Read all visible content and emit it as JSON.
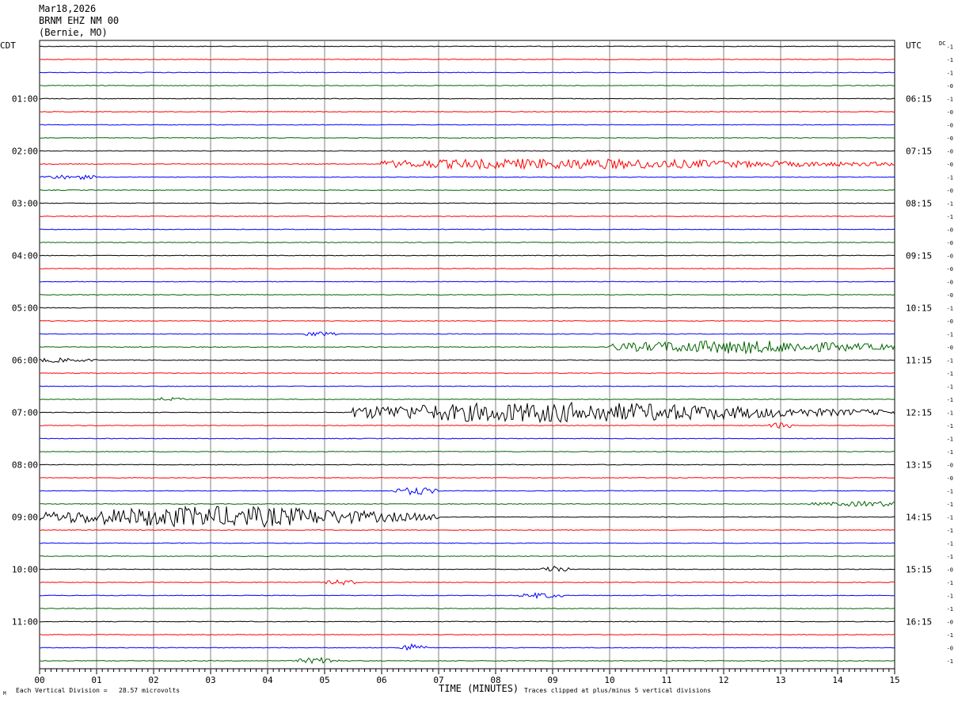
{
  "header": {
    "date": "Mar18,2026",
    "station": "BRNM EHZ NM 00",
    "location": "(Bernie, MO)"
  },
  "labels": {
    "left_tz": "CDT",
    "right_tz": "UTC",
    "dc": "DC",
    "footer_scale": "Each Vertical Division =   28.57 microvolts",
    "footer_title": "TIME (MINUTES)",
    "footer_clip": "Traces clipped at plus/minus 5 vertical divisions",
    "corner_mark": "M"
  },
  "colors": {
    "trace_cycle": [
      "#000000",
      "#ff0000",
      "#0000ff",
      "#006400"
    ],
    "grid": "#808080"
  },
  "chart_data": {
    "type": "helicorder",
    "x_label": "TIME (MINUTES)",
    "x_ticks": [
      "00",
      "01",
      "02",
      "03",
      "04",
      "05",
      "06",
      "07",
      "08",
      "09",
      "10",
      "11",
      "12",
      "13",
      "14",
      "15"
    ],
    "x_range": [
      0,
      15
    ],
    "line_minutes": 15,
    "line_count": 48,
    "left_hour_labels": [
      {
        "line": 4,
        "label": "01:00"
      },
      {
        "line": 8,
        "label": "02:00"
      },
      {
        "line": 12,
        "label": "03:00"
      },
      {
        "line": 16,
        "label": "04:00"
      },
      {
        "line": 20,
        "label": "05:00"
      },
      {
        "line": 24,
        "label": "06:00"
      },
      {
        "line": 28,
        "label": "07:00"
      },
      {
        "line": 32,
        "label": "08:00"
      },
      {
        "line": 36,
        "label": "09:00"
      },
      {
        "line": 40,
        "label": "10:00"
      },
      {
        "line": 44,
        "label": "11:00"
      }
    ],
    "right_hour_labels": [
      {
        "line": 4,
        "label": "06:15"
      },
      {
        "line": 8,
        "label": "07:15"
      },
      {
        "line": 12,
        "label": "08:15"
      },
      {
        "line": 16,
        "label": "09:15"
      },
      {
        "line": 20,
        "label": "10:15"
      },
      {
        "line": 24,
        "label": "11:15"
      },
      {
        "line": 28,
        "label": "12:15"
      },
      {
        "line": 32,
        "label": "13:15"
      },
      {
        "line": 36,
        "label": "14:15"
      },
      {
        "line": 40,
        "label": "15:15"
      },
      {
        "line": 44,
        "label": "16:15"
      }
    ],
    "dc_offsets": [
      "-1",
      "-1",
      "-1",
      "-0",
      "-1",
      "-0",
      "-0",
      "-0",
      "-0",
      "-0",
      "-1",
      "-0",
      "-1",
      "-1",
      "-0",
      "-0",
      "-0",
      "-0",
      "-0",
      "-0",
      "-1",
      "-0",
      "-1",
      "-0",
      "-1",
      "-1",
      "-1",
      "-1",
      "-1",
      "-1",
      "-1",
      "-1",
      "-0",
      "-0",
      "-1",
      "-1",
      "-1",
      "-1",
      "-1",
      "-1",
      "-0",
      "-1",
      "-1",
      "-1",
      "-0",
      "-1",
      "-0",
      "-1"
    ],
    "events": [
      {
        "line": 9,
        "start_min": 6.0,
        "end_min": 15.0,
        "peak_min": 9.1,
        "amp": 5,
        "base": 1.2
      },
      {
        "line": 10,
        "start_min": 0.0,
        "end_min": 1.0,
        "peak_min": 0.6,
        "amp": 2,
        "base": 0.6
      },
      {
        "line": 22,
        "start_min": 4.6,
        "end_min": 5.2,
        "peak_min": 4.9,
        "amp": 2,
        "base": 0.5
      },
      {
        "line": 23,
        "start_min": 10.0,
        "end_min": 15.0,
        "peak_min": 12.2,
        "amp": 6,
        "base": 1.8
      },
      {
        "line": 24,
        "start_min": 0.0,
        "end_min": 1.0,
        "peak_min": 0.3,
        "amp": 1.5,
        "base": 0.8
      },
      {
        "line": 27,
        "start_min": 2.0,
        "end_min": 2.6,
        "peak_min": 2.3,
        "amp": 2,
        "base": 0.5
      },
      {
        "line": 28,
        "start_min": 5.5,
        "end_min": 15.0,
        "peak_min": 9.0,
        "amp": 11,
        "base": 1.2
      },
      {
        "line": 29,
        "start_min": 12.8,
        "end_min": 13.3,
        "peak_min": 13.0,
        "amp": 3,
        "base": 0.6
      },
      {
        "line": 34,
        "start_min": 6.2,
        "end_min": 7.0,
        "peak_min": 6.6,
        "amp": 4,
        "base": 0.6
      },
      {
        "line": 35,
        "start_min": 13.5,
        "end_min": 15.0,
        "peak_min": 14.6,
        "amp": 2,
        "base": 1.0
      },
      {
        "line": 36,
        "start_min": 0.0,
        "end_min": 7.0,
        "peak_min": 3.1,
        "amp": 12,
        "base": 1.0
      },
      {
        "line": 40,
        "start_min": 8.8,
        "end_min": 9.3,
        "peak_min": 9.0,
        "amp": 5,
        "base": 0.6
      },
      {
        "line": 41,
        "start_min": 5.0,
        "end_min": 5.6,
        "peak_min": 5.3,
        "amp": 2.5,
        "base": 0.5
      },
      {
        "line": 42,
        "start_min": 8.4,
        "end_min": 9.2,
        "peak_min": 8.8,
        "amp": 2.5,
        "base": 0.5
      },
      {
        "line": 46,
        "start_min": 6.3,
        "end_min": 6.8,
        "peak_min": 6.5,
        "amp": 4,
        "base": 0.6
      },
      {
        "line": 47,
        "start_min": 4.5,
        "end_min": 5.3,
        "peak_min": 4.9,
        "amp": 3,
        "base": 0.6
      }
    ]
  }
}
